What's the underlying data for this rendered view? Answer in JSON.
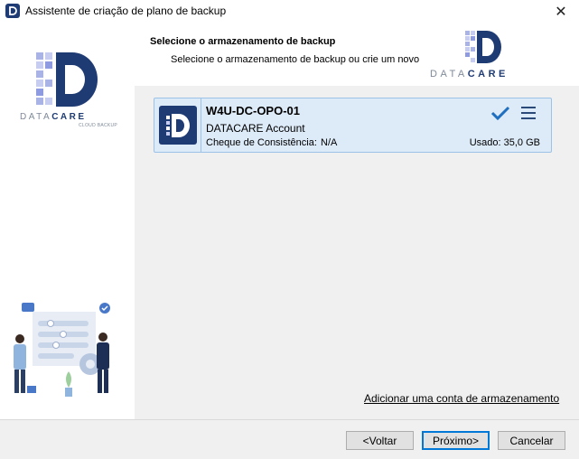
{
  "window": {
    "title": "Assistente de criação de plano de backup",
    "close_glyph": "✕"
  },
  "branding": {
    "brand_light": "DATA",
    "brand_bold": "CARE",
    "brand_sub": "CLOUD BACKUP",
    "brand_color": "#1f3b73"
  },
  "header": {
    "title": "Selecione o armazenamento de backup",
    "subtitle": "Selecione o armazenamento de backup ou crie um novo"
  },
  "storage": {
    "items": [
      {
        "name": "W4U-DC-OPO-01",
        "account": "DATACARE Account",
        "check_label": "Cheque de Consistência:",
        "check_value": "N/A",
        "used": "Usado: 35,0 GB",
        "selected": true
      }
    ]
  },
  "links": {
    "add_storage": "Adicionar uma conta de armazenamento"
  },
  "footer": {
    "back": "<Voltar",
    "next": "Próximo>",
    "cancel": "Cancelar"
  },
  "icons": {
    "check": "checkmark-icon",
    "menu": "hamburger-menu-icon",
    "close": "close-icon"
  }
}
